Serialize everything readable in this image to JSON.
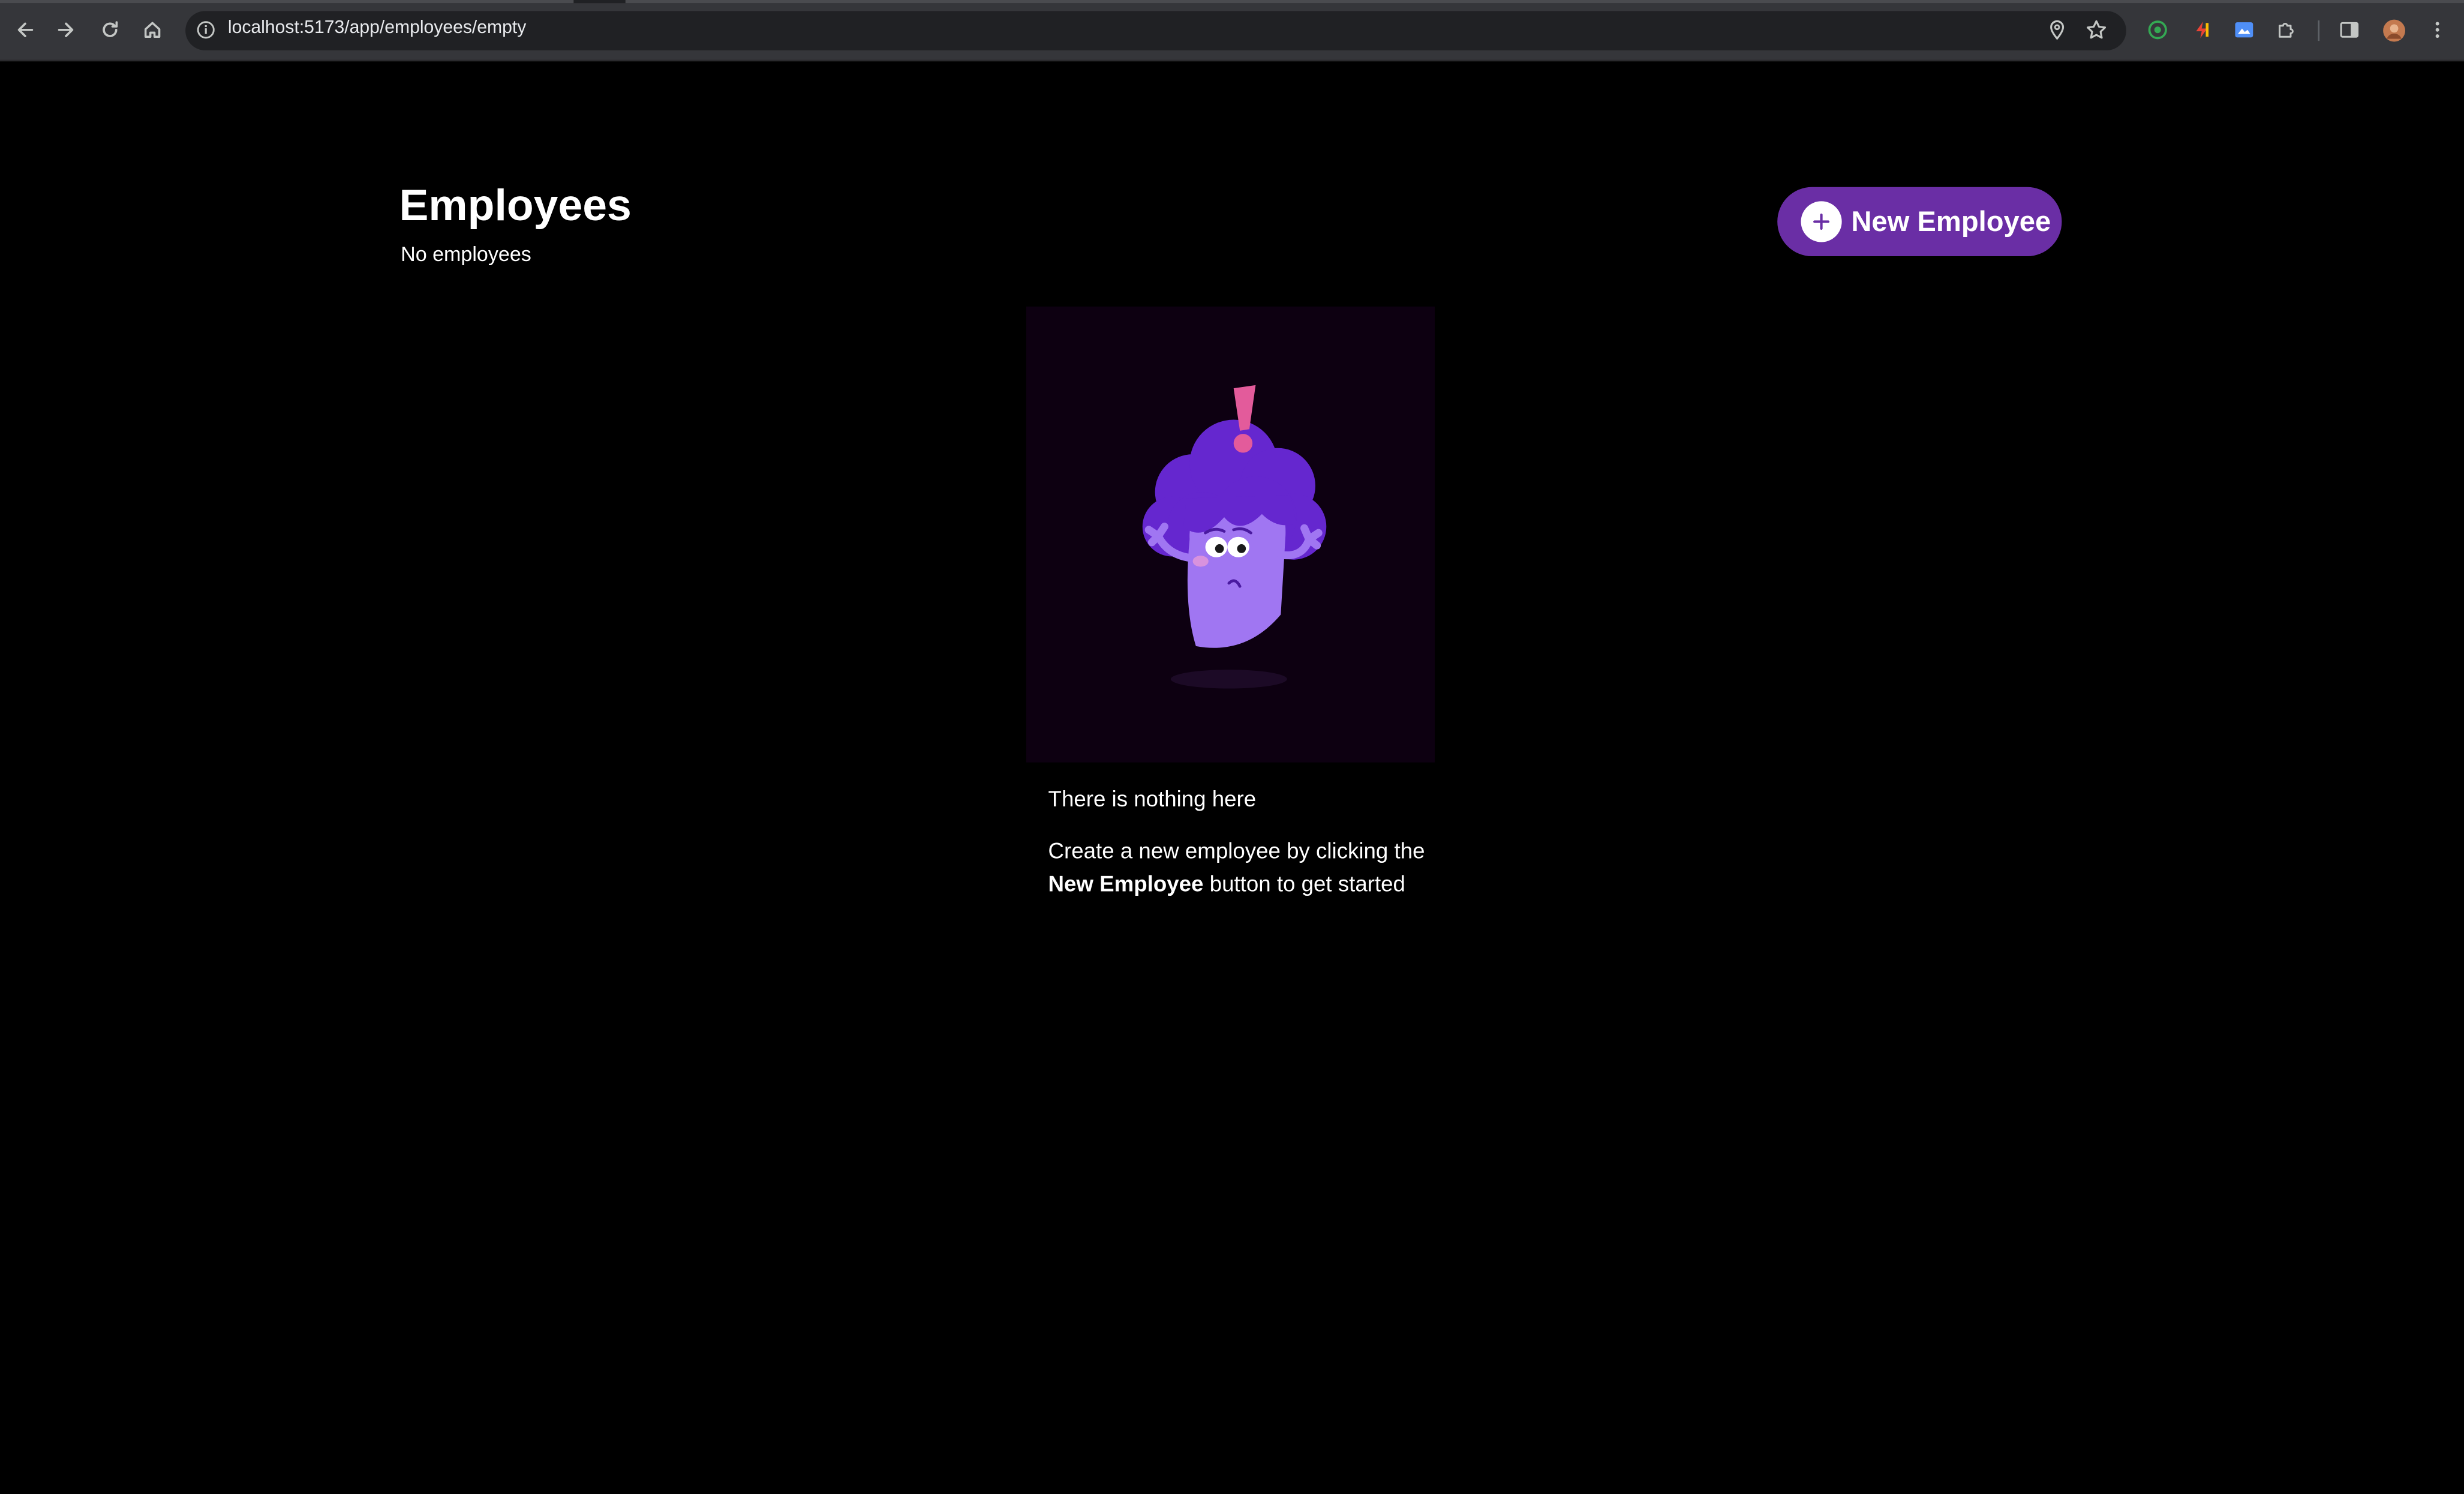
{
  "browser": {
    "url": "localhost:5173/app/employees/empty"
  },
  "page": {
    "title": "Employees",
    "subtitle": "No employees",
    "new_button_label": "New Employee"
  },
  "empty_state": {
    "title": "There is nothing here",
    "desc_prefix": "Create a new employee by clicking the",
    "desc_emphasis": "New Employee",
    "desc_suffix": "button to get started"
  },
  "colors": {
    "background": "#000000",
    "accent": "#6a2ea5",
    "illustration_bg": "#0d0011"
  }
}
